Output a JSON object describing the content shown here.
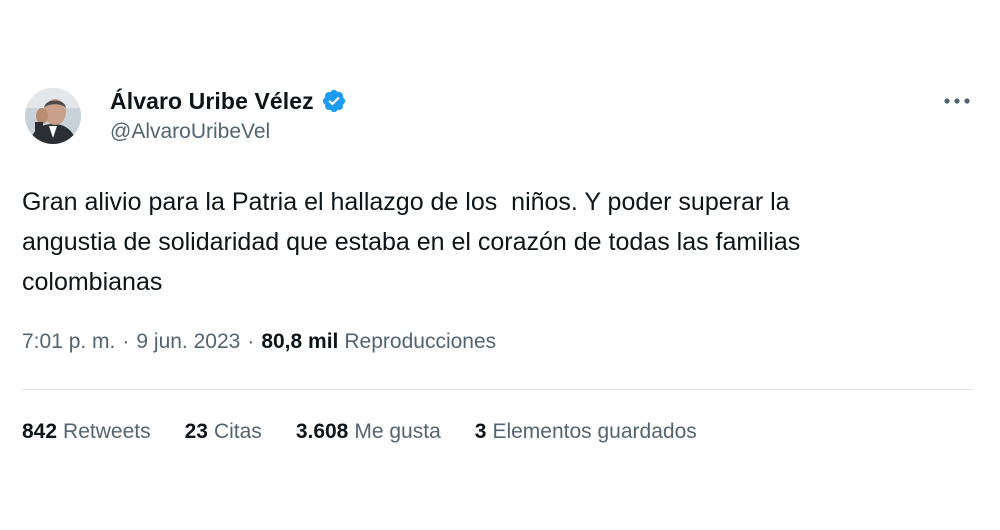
{
  "author": {
    "display_name": "Álvaro Uribe Vélez",
    "handle": "@AlvaroUribeVel",
    "verified_icon": "verified-badge-icon",
    "avatar": "profile-photo"
  },
  "more_icon": "ellipsis-icon",
  "tweet": {
    "text": "Gran alivio para la Patria el hallazgo de los  niños. Y poder superar la\nangustia de solidaridad que estaba en el corazón de todas las familias\ncolombianas"
  },
  "meta": {
    "time": "7:01 p. m.",
    "separator": "·",
    "date": "9 jun. 2023",
    "views_count": "80,8 mil",
    "views_label": "Reproducciones"
  },
  "stats": [
    {
      "count": "842",
      "label": "Retweets"
    },
    {
      "count": "23",
      "label": "Citas"
    },
    {
      "count": "3.608",
      "label": "Me gusta"
    },
    {
      "count": "3",
      "label": "Elementos guardados"
    }
  ],
  "colors": {
    "text": "#0f1419",
    "secondary": "#536471",
    "verified": "#1d9bf0",
    "divider": "#e1e6ea"
  }
}
